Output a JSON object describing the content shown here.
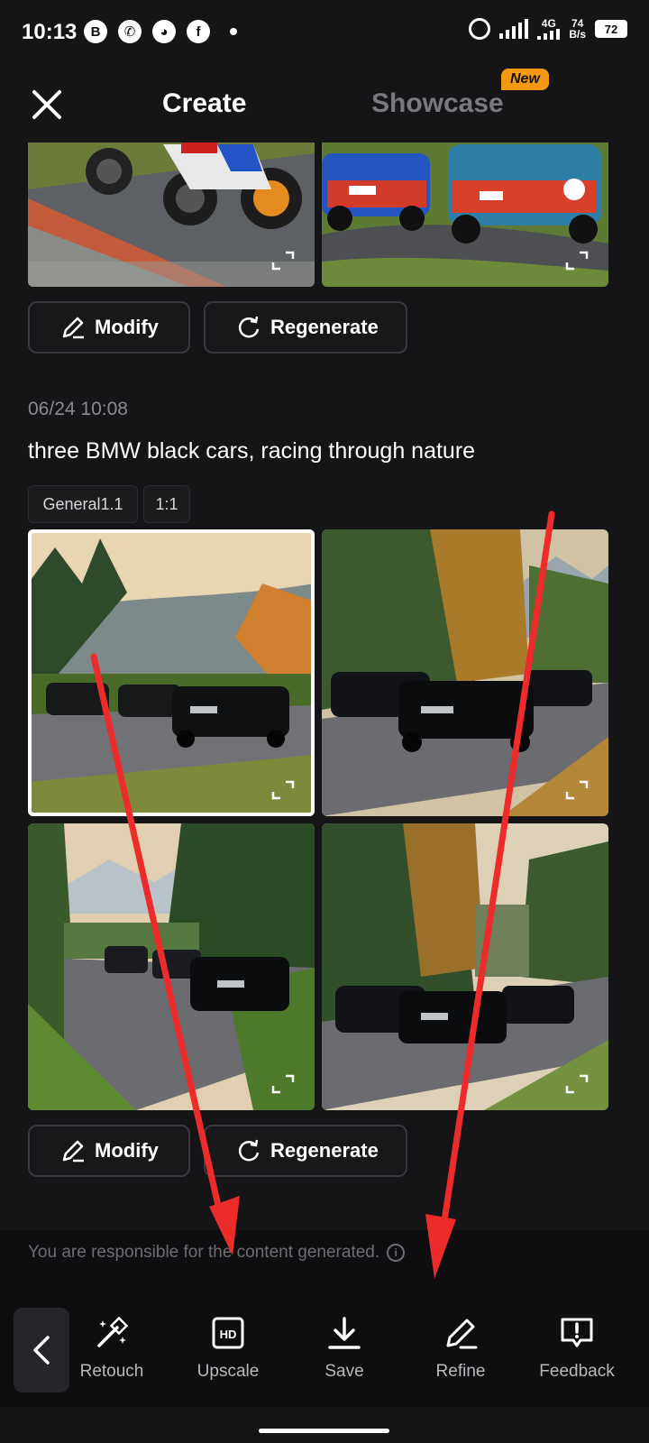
{
  "status_bar": {
    "time": "10:13",
    "icons_left": [
      "b-icon",
      "whatsapp-icon",
      "discord-icon",
      "facebook-icon"
    ],
    "net_type": "4G",
    "speed_value": "74",
    "speed_unit": "B/s",
    "battery": "72"
  },
  "header": {
    "tab_create": "Create",
    "tab_showcase": "Showcase",
    "new_badge": "New"
  },
  "group1": {
    "modify_label": "Modify",
    "regenerate_label": "Regenerate"
  },
  "group2": {
    "timestamp": "06/24 10:08",
    "prompt": "three BMW black cars, racing through nature",
    "tags": [
      "General1.1",
      "1:1"
    ],
    "modify_label": "Modify",
    "regenerate_label": "Regenerate"
  },
  "disclaimer": "You are responsible for the content generated.",
  "toolbar": {
    "retouch": "Retouch",
    "upscale": "Upscale",
    "save": "Save",
    "refine": "Refine",
    "feedback": "Feedback"
  },
  "colors": {
    "background": "#151517",
    "accent_badge": "#f39a12",
    "annotation_arrow": "#ee2b2b"
  }
}
